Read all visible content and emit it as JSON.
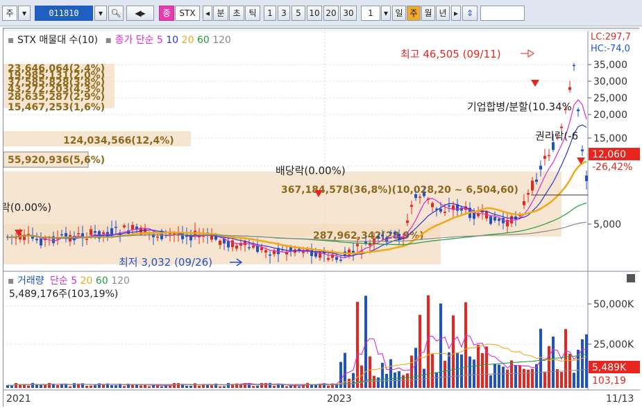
{
  "toolbar": {
    "market_label": "주",
    "stock_code": "011810",
    "stock_name_badge": "종",
    "stock_name": "STX",
    "period_label": "분",
    "period_label2": "초",
    "period_label3": "틱",
    "intervals": [
      "1",
      "3",
      "5",
      "10",
      "20",
      "30"
    ],
    "count": "1",
    "period_day": "일",
    "period_week": "주",
    "period_month": "월",
    "period_year": "년"
  },
  "price_panel": {
    "legend_title": "STX 매물대 수(10)",
    "ma_label": "종가 단순",
    "ma_periods": [
      "5",
      "10",
      "20",
      "60",
      "120"
    ],
    "lc_label": "LC:297,7",
    "hc_label": "HC:-74,0",
    "price_axis": [
      "35,000",
      "30,000",
      "25,000",
      "20,000",
      "15,000",
      "5,000"
    ],
    "current_price": "12,060",
    "current_change": "-26,42%",
    "high_marker": "최고 46,505 (09/11)",
    "low_marker": "최저 3,032 (09/26)",
    "dividend_event": "배당락(0.00%)",
    "rights_event_left": "락(0.00%)",
    "merger_event": "기업합병/분할(10.34%",
    "rights_event": "권리락(-6",
    "volume_profile": [
      "23,646,064(2,4%)",
      "19,985,131(2,0%)",
      "37,585,828(3,8%)",
      "43,272,203(4,3%)",
      "28,635,287(2,9%)",
      "15,467,253(1,6%)",
      "124,034,566(12,4%)",
      "55,920,936(5,6%)",
      "367,184,578(36,8%)(10,028,20 ~ 6,504,60)",
      "287,962,342(28,9%)"
    ]
  },
  "volume_panel": {
    "legend_title": "거래량",
    "ma_label": "단순",
    "ma_periods": [
      "5",
      "20",
      "60",
      "120"
    ],
    "value_label": "5,489,176주(103,19%)",
    "axis": [
      "50,000K",
      "25,000K"
    ],
    "current_volume": "5,489K",
    "current_ratio": "103,19"
  },
  "time_axis": [
    "2021",
    "2023",
    "11/13"
  ],
  "colors": {
    "up": "#e8261f",
    "down": "#1f52c9",
    "ma5": "#d92ad0",
    "ma10": "#2a36d6",
    "ma20": "#f0a817",
    "ma60": "#1f9e3c",
    "ma120": "#8a8a8a",
    "profile": "#f3dcc0"
  }
}
